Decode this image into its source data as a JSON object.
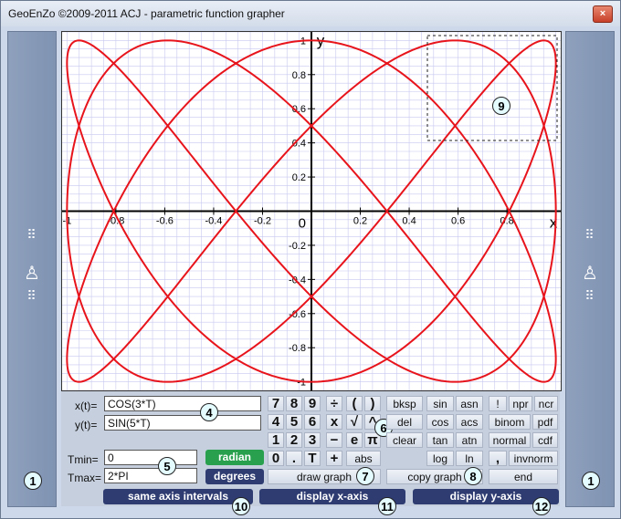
{
  "window": {
    "title": "GeoEnZo ©2009-2011 ACJ - parametric function grapher",
    "close_label": "×"
  },
  "side": {
    "dots": "⠿",
    "stamp": "♙"
  },
  "markers": {
    "m1": "1",
    "m4": "4",
    "m5": "5",
    "m6": "6",
    "m7": "7",
    "m8": "8",
    "m9": "9",
    "m10": "10",
    "m11": "11",
    "m12": "12"
  },
  "graph": {
    "x_axis_label": "x",
    "y_axis_label": "y",
    "origin_label": "0",
    "x_ticks": [
      -1,
      -0.8,
      -0.6,
      -0.4,
      -0.2,
      0.2,
      0.4,
      0.6,
      0.8
    ],
    "x_tick_labels": [
      "-1",
      "-0.8",
      "-0.6",
      "-0.4",
      "-0.2",
      "0.2",
      "0.4",
      "0.6",
      "0.8"
    ],
    "y_ticks": [
      1,
      0.8,
      0.6,
      0.4,
      0.2,
      -0.2,
      -0.4,
      -0.6,
      -0.8,
      -1
    ],
    "y_tick_labels": [
      "1",
      "0.8",
      "0.6",
      "0.4",
      "0.2",
      "-0.2",
      "-0.4",
      "-0.6",
      "-0.8",
      "-1"
    ],
    "xlim": [
      -1.02,
      1.02
    ],
    "ylim": [
      -1.05,
      1.05
    ],
    "curve_color": "#e8141c",
    "grid_color": "#c8c8f0"
  },
  "inputs": {
    "x_label": "x(t)=",
    "x_value": "COS(3*T)",
    "y_label": "y(t)=",
    "y_value": "SIN(5*T)",
    "tmin_label": "Tmin=",
    "tmin_value": "0",
    "tmax_label": "Tmax=",
    "tmax_value": "2*PI"
  },
  "angle": {
    "radian": "radian",
    "degrees": "degrees"
  },
  "keypad": {
    "digits": [
      "7",
      "8",
      "9",
      "4",
      "5",
      "6",
      "1",
      "2",
      "3",
      "0",
      ".",
      "T"
    ],
    "ops": [
      "÷",
      "x",
      "−",
      "+"
    ],
    "extra": [
      "(",
      ")",
      "√",
      "^",
      "e",
      "π",
      "abs"
    ],
    "edit": [
      "bksp",
      "del",
      "clear"
    ],
    "funcs": [
      "sin",
      "asn",
      "cos",
      "acs",
      "tan",
      "atn",
      "log",
      "ln"
    ],
    "stats": [
      "!",
      "npr",
      "ncr",
      "binom",
      "pdf",
      "normal",
      "cdf",
      ",",
      "invnorm"
    ],
    "end": "end",
    "draw_graph": "draw graph",
    "copy_graph": "copy graph"
  },
  "bottom_buttons": {
    "same_axis": "same axis intervals",
    "display_x": "display x-axis",
    "display_y": "display y-axis"
  }
}
